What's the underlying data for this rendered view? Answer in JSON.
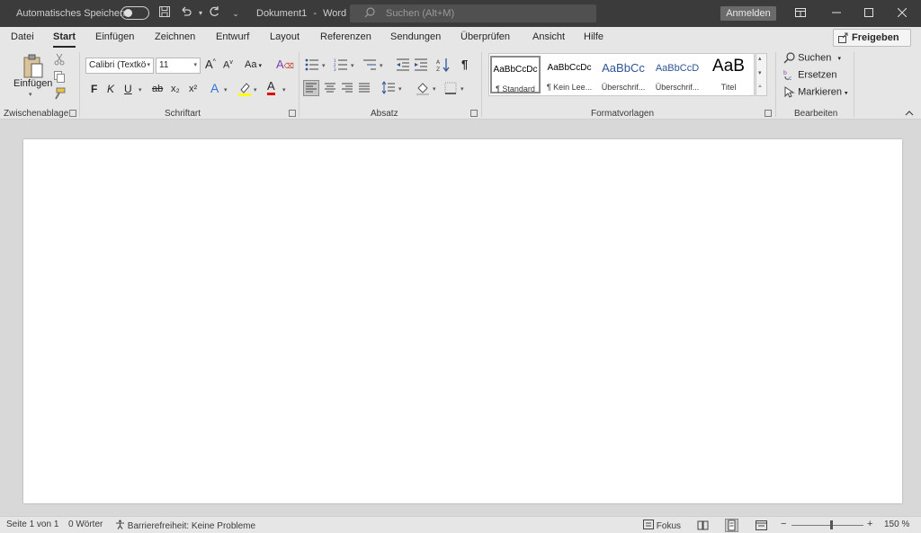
{
  "titlebar": {
    "autosave_label": "Automatisches Speichern",
    "doc_title": "Dokument1",
    "app_separator": "-",
    "app_name": "Word",
    "search_placeholder": "Suchen (Alt+M)",
    "signin_label": "Anmelden"
  },
  "tabs": [
    "Datei",
    "Start",
    "Einfügen",
    "Zeichnen",
    "Entwurf",
    "Layout",
    "Referenzen",
    "Sendungen",
    "Überprüfen",
    "Ansicht",
    "Hilfe"
  ],
  "share_label": "Freigeben",
  "ribbon": {
    "clipboard": {
      "paste_label": "Einfügen",
      "group_label": "Zwischenablage"
    },
    "font": {
      "font_name": "Calibri (Textkö",
      "font_size": "11",
      "change_case": "Aa",
      "bold": "F",
      "italic": "K",
      "underline": "U",
      "strikethrough": "ab",
      "subscript": "x₂",
      "superscript": "x²",
      "text_effects": "A",
      "font_color": "A",
      "group_label": "Schriftart"
    },
    "paragraph": {
      "group_label": "Absatz"
    },
    "styles": {
      "group_label": "Formatvorlagen",
      "items": [
        {
          "preview": "AaBbCcDc",
          "label": "¶ Standard"
        },
        {
          "preview": "AaBbCcDc",
          "label": "¶ Kein Lee..."
        },
        {
          "preview": "AaBbCc",
          "label": "Überschrif..."
        },
        {
          "preview": "AaBbCcD",
          "label": "Überschrif..."
        },
        {
          "preview": "AaB",
          "label": "Titel"
        }
      ]
    },
    "editing": {
      "group_label": "Bearbeiten",
      "find": "Suchen",
      "replace": "Ersetzen",
      "select": "Markieren"
    }
  },
  "statusbar": {
    "page": "Seite 1 von 1",
    "words": "0 Wörter",
    "accessibility": "Barrierefreiheit: Keine Probleme",
    "focus": "Fokus",
    "zoom_minus": "−",
    "zoom_plus": "+",
    "zoom": "150 %"
  },
  "colors": {
    "titlebar": "#3b3b3b",
    "ribbon": "#e6e6e6",
    "workspace": "#d8d8d8",
    "highlight": "#ffff00",
    "font_color": "#e00000",
    "heading_blue": "#2f5496"
  },
  "icons": [
    "paste-icon",
    "cut-icon",
    "copy-icon",
    "format-painter-icon",
    "save-icon",
    "undo-icon",
    "redo-icon",
    "search-icon",
    "bullets-icon",
    "numbering-icon",
    "multilevel-list-icon",
    "decrease-indent-icon",
    "increase-indent-icon",
    "sort-icon",
    "pilcrow-icon",
    "align-left-icon",
    "align-center-icon",
    "align-right-icon",
    "justify-icon",
    "line-spacing-icon",
    "shading-icon",
    "borders-icon",
    "find-icon",
    "replace-icon",
    "select-icon",
    "focus-icon",
    "read-mode-icon",
    "print-layout-icon",
    "web-layout-icon"
  ]
}
